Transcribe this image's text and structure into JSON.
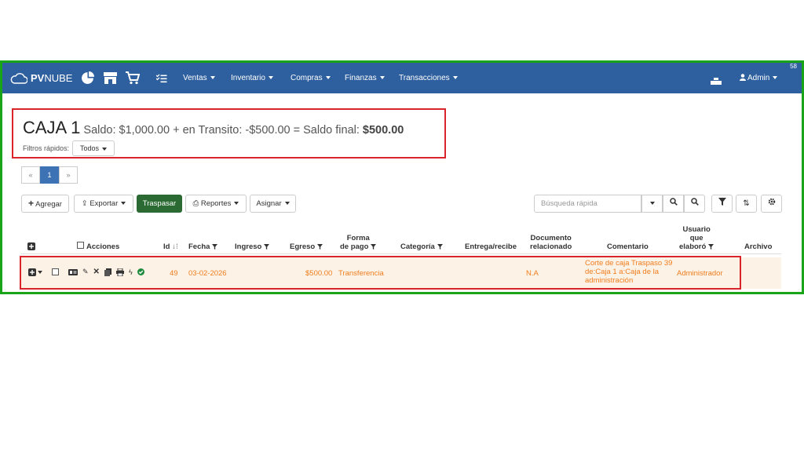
{
  "navbar": {
    "logo_pv": "PV",
    "logo_nube": "NUBE",
    "menu": [
      "Ventas",
      "Inventario",
      "Compras",
      "Finanzas",
      "Transacciones"
    ],
    "user": "Admin",
    "corner_number": "58"
  },
  "summary": {
    "caja": "CAJA 1",
    "saldo_text": " Saldo: $1,000.00 + en Transito: -$500.00 = Saldo final: ",
    "saldo_final": "$500.00",
    "filtros_label": "Filtros rápidos:",
    "filtro_value": "Todos"
  },
  "pagination": {
    "prev": "«",
    "current": "1",
    "next": "»"
  },
  "toolbar": {
    "agregar": "Agregar",
    "exportar": "Exportar",
    "traspasar": "Traspasar",
    "reportes": "Reportes",
    "asignar": "Asignar",
    "search_placeholder": "Búsqueda rápida"
  },
  "table": {
    "headers": {
      "acciones": "Acciones",
      "id": "Id",
      "fecha": "Fecha",
      "ingreso": "Ingreso",
      "egreso": "Egreso",
      "forma_1": "Forma",
      "forma_2": "de pago",
      "categoria": "Categoría",
      "entrega": "Entrega/recibe",
      "doc_1": "Documento",
      "doc_2": "relacionado",
      "comentario": "Comentario",
      "usuario_1": "Usuario",
      "usuario_2": "que",
      "usuario_3": "elaboró",
      "archivo": "Archivo"
    },
    "rows": [
      {
        "id": "49",
        "fecha": "03-02-2026",
        "ingreso": "",
        "egreso": "$500.00",
        "forma_pago": "Transferencia",
        "categoria": "",
        "entrega": "",
        "documento": "N.A",
        "comentario": "Corte de caja Traspaso 39 de:Caja 1 a:Caja de la administración",
        "usuario": "Administrador",
        "archivo": ""
      }
    ]
  },
  "colors": {
    "navbar": "#2e5f9e",
    "accent_orange": "#f07d1e",
    "traspasar_green": "#2b6b33",
    "highlight_red": "#d9252a",
    "frame_green": "#1aa41a"
  }
}
